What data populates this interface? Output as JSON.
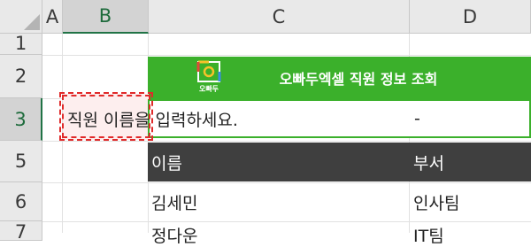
{
  "columns": [
    {
      "key": "A",
      "label": "A"
    },
    {
      "key": "B",
      "label": "B"
    },
    {
      "key": "C",
      "label": "C"
    },
    {
      "key": "D",
      "label": "D"
    }
  ],
  "rows": [
    {
      "label": "1"
    },
    {
      "label": "2"
    },
    {
      "label": "3"
    },
    {
      "label": "5"
    },
    {
      "label": "6"
    },
    {
      "label": "7"
    }
  ],
  "banner": {
    "title": "오빠두엑셀 직원 정보 조회",
    "logo_text": "오빠두"
  },
  "input_row": {
    "prompt": "직원 이름을 입력하세요.",
    "result": "-"
  },
  "table": {
    "headers": [
      "이름",
      "부서"
    ],
    "rows": [
      [
        "김세민",
        "인사팀"
      ],
      [
        "정다운",
        "IT팀"
      ]
    ]
  },
  "colors": {
    "banner_green": "#3bb02b",
    "header_dark": "#3f3f3f",
    "highlight_red": "#e02a2a",
    "selection_green": "#217346"
  }
}
